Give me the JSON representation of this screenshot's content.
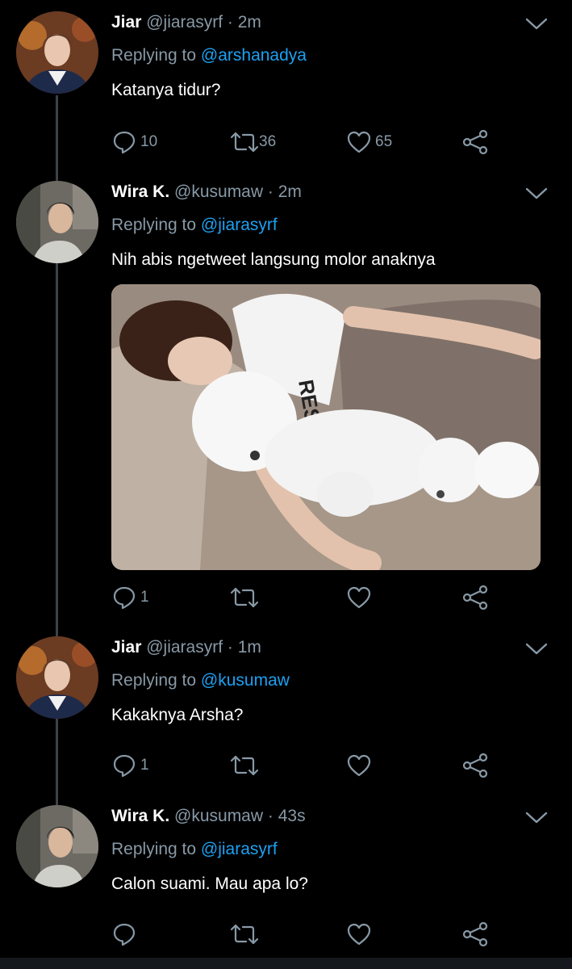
{
  "colors": {
    "background": "#000000",
    "secondary_text": "#8899a6",
    "link": "#1da1f2",
    "thread_line": "#3d4148"
  },
  "icons": [
    "chevron-down-icon",
    "reply-icon",
    "retweet-icon",
    "like-icon",
    "share-icon"
  ],
  "tweets": [
    {
      "name": "Jiar",
      "handle": "@jiarasyrf",
      "time": "2m",
      "replying_prefix": "Replying to",
      "replying_to": "@arshanadya",
      "text": "Katanya tidur?",
      "replies": "10",
      "retweets": "36",
      "likes": "65"
    },
    {
      "name": "Wira K.",
      "handle": "@kusumaw",
      "time": "2m",
      "replying_prefix": "Replying to",
      "replying_to": "@jiarasyrf",
      "text": "Nih abis ngetweet langsung molor anaknya",
      "replies": "1",
      "retweets": "",
      "likes": ""
    },
    {
      "name": "Jiar",
      "handle": "@jiarasyrf",
      "time": "1m",
      "replying_prefix": "Replying to",
      "replying_to": "@kusumaw",
      "text": "Kakaknya Arsha?",
      "replies": "1",
      "retweets": "",
      "likes": ""
    },
    {
      "name": "Wira K.",
      "handle": "@kusumaw",
      "time": "43s",
      "replying_prefix": "Replying to",
      "replying_to": "@jiarasyrf",
      "text": "Calon suami. Mau apa lo?",
      "replies": "",
      "retweets": "",
      "likes": ""
    }
  ]
}
